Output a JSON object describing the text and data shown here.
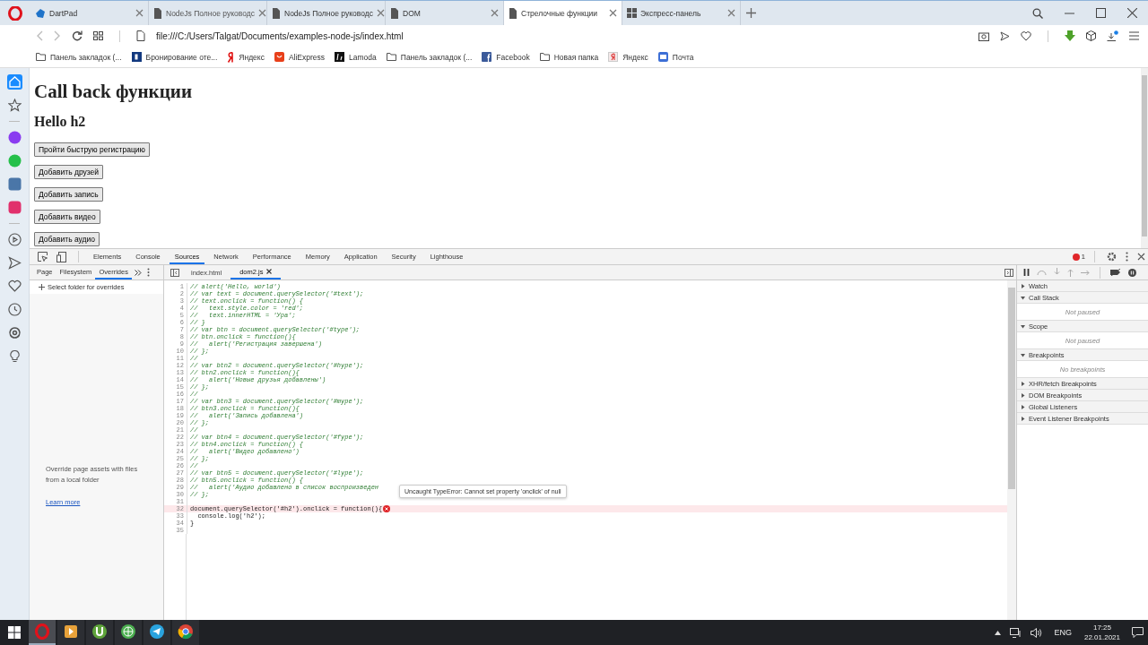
{
  "browser_tabs": [
    {
      "title": "DartPad",
      "kind": "dart",
      "selected": false
    },
    {
      "title": "NodeJs Полное руководс",
      "kind": "page",
      "selected": false
    },
    {
      "title": "NodeJs Полное руководс",
      "kind": "page",
      "selected": false
    },
    {
      "title": "DOM",
      "kind": "page",
      "selected": false
    },
    {
      "title": "Стрелочные функции",
      "kind": "page",
      "selected": true
    },
    {
      "title": "Экспресс-панель",
      "kind": "dial",
      "selected": false
    }
  ],
  "address_bar": {
    "url": "file:///C:/Users/Talgat/Documents/examples-node-js/index.html"
  },
  "bookmarks": [
    {
      "label": "Панель закладок (...",
      "kind": "folder"
    },
    {
      "label": "Бронирование оте...",
      "kind": "booking"
    },
    {
      "label": "Яндекс",
      "kind": "yandex"
    },
    {
      "label": "AliExpress",
      "kind": "ali"
    },
    {
      "label": "Lamoda",
      "kind": "lamoda"
    },
    {
      "label": "Панель закладок (...",
      "kind": "folder"
    },
    {
      "label": "Facebook",
      "kind": "facebook"
    },
    {
      "label": "Новая папка",
      "kind": "folder"
    },
    {
      "label": "Яндекс",
      "kind": "yandex2"
    },
    {
      "label": "Почта",
      "kind": "mail"
    }
  ],
  "sidebar": {
    "items": [
      {
        "selected": true
      },
      {
        "selected": false
      },
      {
        "selected": false
      },
      {
        "selected": false
      },
      {
        "selected": false
      },
      {
        "selected": false
      },
      {
        "selected": false
      },
      {
        "selected": false
      },
      {
        "selected": false
      },
      {
        "selected": false
      },
      {
        "selected": false
      },
      {
        "selected": false
      }
    ]
  },
  "page": {
    "heading": "Call back функции",
    "subheading": "Hello h2",
    "buttons": [
      "Пройти быструю регистрацию",
      "Добавить друзей",
      "Добавить запись",
      "Добавить видео",
      "Добавить аудио"
    ]
  },
  "devtools": {
    "tabs": [
      {
        "label": "Elements",
        "selected": false
      },
      {
        "label": "Console",
        "selected": false
      },
      {
        "label": "Sources",
        "selected": true
      },
      {
        "label": "Network",
        "selected": false
      },
      {
        "label": "Performance",
        "selected": false
      },
      {
        "label": "Memory",
        "selected": false
      },
      {
        "label": "Application",
        "selected": false
      },
      {
        "label": "Security",
        "selected": false
      },
      {
        "label": "Lighthouse",
        "selected": false
      }
    ],
    "error_count": "1",
    "navigator_tabs": [
      {
        "label": "Page",
        "selected": false
      },
      {
        "label": "Filesystem",
        "selected": false
      },
      {
        "label": "Overrides",
        "selected": true
      }
    ],
    "select_folder": "Select folder for overrides",
    "overrides_hint": "Override page assets with files from a local folder",
    "learn_more": "Learn more",
    "editor_tabs": [
      {
        "label": "index.html",
        "selected": false
      },
      {
        "label": "dom2.js",
        "selected": true
      }
    ],
    "code_lines": [
      {
        "number": "1",
        "text": "// alert('Hello, world')",
        "kind": "comment",
        "error": false
      },
      {
        "number": "2",
        "text": "// var text = document.querySelector('#text');",
        "kind": "comment",
        "error": false
      },
      {
        "number": "3",
        "text": "// text.onclick = function() {",
        "kind": "comment",
        "error": false
      },
      {
        "number": "4",
        "text": "//   text.style.color = 'red';",
        "kind": "comment",
        "error": false
      },
      {
        "number": "5",
        "text": "//   text.innerHTML = 'Ура';",
        "kind": "comment",
        "error": false
      },
      {
        "number": "6",
        "text": "// }",
        "kind": "comment",
        "error": false
      },
      {
        "number": "7",
        "text": "// var btn = document.querySelector('#type');",
        "kind": "comment",
        "error": false
      },
      {
        "number": "8",
        "text": "// btn.onclick = function(){",
        "kind": "comment",
        "error": false
      },
      {
        "number": "9",
        "text": "//   alert('Регистрация завершена')",
        "kind": "comment",
        "error": false
      },
      {
        "number": "10",
        "text": "// };",
        "kind": "comment",
        "error": false
      },
      {
        "number": "11",
        "text": "//",
        "kind": "comment",
        "error": false
      },
      {
        "number": "12",
        "text": "// var btn2 = document.querySelector('#hype');",
        "kind": "comment",
        "error": false
      },
      {
        "number": "13",
        "text": "// btn2.onclick = function(){",
        "kind": "comment",
        "error": false
      },
      {
        "number": "14",
        "text": "//   alert('Новые друзья добавлены')",
        "kind": "comment",
        "error": false
      },
      {
        "number": "15",
        "text": "// };",
        "kind": "comment",
        "error": false
      },
      {
        "number": "16",
        "text": "//",
        "kind": "comment",
        "error": false
      },
      {
        "number": "17",
        "text": "// var btn3 = document.querySelector('#mype');",
        "kind": "comment",
        "error": false
      },
      {
        "number": "18",
        "text": "// btn3.onclick = function(){",
        "kind": "comment",
        "error": false
      },
      {
        "number": "19",
        "text": "//   alert('Запись добавлена')",
        "kind": "comment",
        "error": false
      },
      {
        "number": "20",
        "text": "// };",
        "kind": "comment",
        "error": false
      },
      {
        "number": "21",
        "text": "//",
        "kind": "comment",
        "error": false
      },
      {
        "number": "22",
        "text": "// var btn4 = document.querySelector('#fype');",
        "kind": "comment",
        "error": false
      },
      {
        "number": "23",
        "text": "// btn4.onclick = function() {",
        "kind": "comment",
        "error": false
      },
      {
        "number": "24",
        "text": "//   alert('Видео добавлено')",
        "kind": "comment",
        "error": false
      },
      {
        "number": "25",
        "text": "// };",
        "kind": "comment",
        "error": false
      },
      {
        "number": "26",
        "text": "//",
        "kind": "comment",
        "error": false
      },
      {
        "number": "27",
        "text": "// var btn5 = document.querySelector('#lype');",
        "kind": "comment",
        "error": false
      },
      {
        "number": "28",
        "text": "// btn5.onclick = function() {",
        "kind": "comment",
        "error": false
      },
      {
        "number": "29",
        "text": "//   alert('Аудио добавлено в список воспроизведен",
        "kind": "comment",
        "error": false
      },
      {
        "number": "30",
        "text": "// };",
        "kind": "comment",
        "error": false
      },
      {
        "number": "31",
        "error": false
      },
      {
        "number": "32",
        "text": "document.querySelector('#h2').onclick = function(){",
        "kind": "code",
        "error": true
      },
      {
        "number": "33",
        "text": "  console.log('h2');",
        "kind": "code",
        "error": false
      },
      {
        "number": "34",
        "text": "}",
        "kind": "code",
        "error": false
      },
      {
        "number": "35",
        "error": false
      }
    ],
    "error_tooltip": "Uncaught TypeError: Cannot set property 'onclick' of null",
    "debugger_sections": [
      {
        "title": "Watch",
        "expanded": false
      },
      {
        "title": "Call Stack",
        "expanded": true,
        "body": "Not paused"
      },
      {
        "title": "Scope",
        "expanded": true,
        "body": "Not paused"
      },
      {
        "title": "Breakpoints",
        "expanded": true,
        "body": "No breakpoints"
      },
      {
        "title": "XHR/fetch Breakpoints",
        "expanded": false
      },
      {
        "title": "DOM Breakpoints",
        "expanded": false
      },
      {
        "title": "Global Listeners",
        "expanded": false
      },
      {
        "title": "Event Listener Breakpoints",
        "expanded": false
      }
    ]
  },
  "taskbar": {
    "apps": [
      {
        "kind": "opera",
        "selected": true
      },
      {
        "kind": "media",
        "selected": false
      },
      {
        "kind": "torrent",
        "selected": false
      },
      {
        "kind": "globe",
        "selected": false
      },
      {
        "kind": "telegram",
        "selected": false
      },
      {
        "kind": "chrome",
        "selected": false
      }
    ],
    "language": "ENG",
    "time": "17:25",
    "date": "22.01.2021"
  }
}
